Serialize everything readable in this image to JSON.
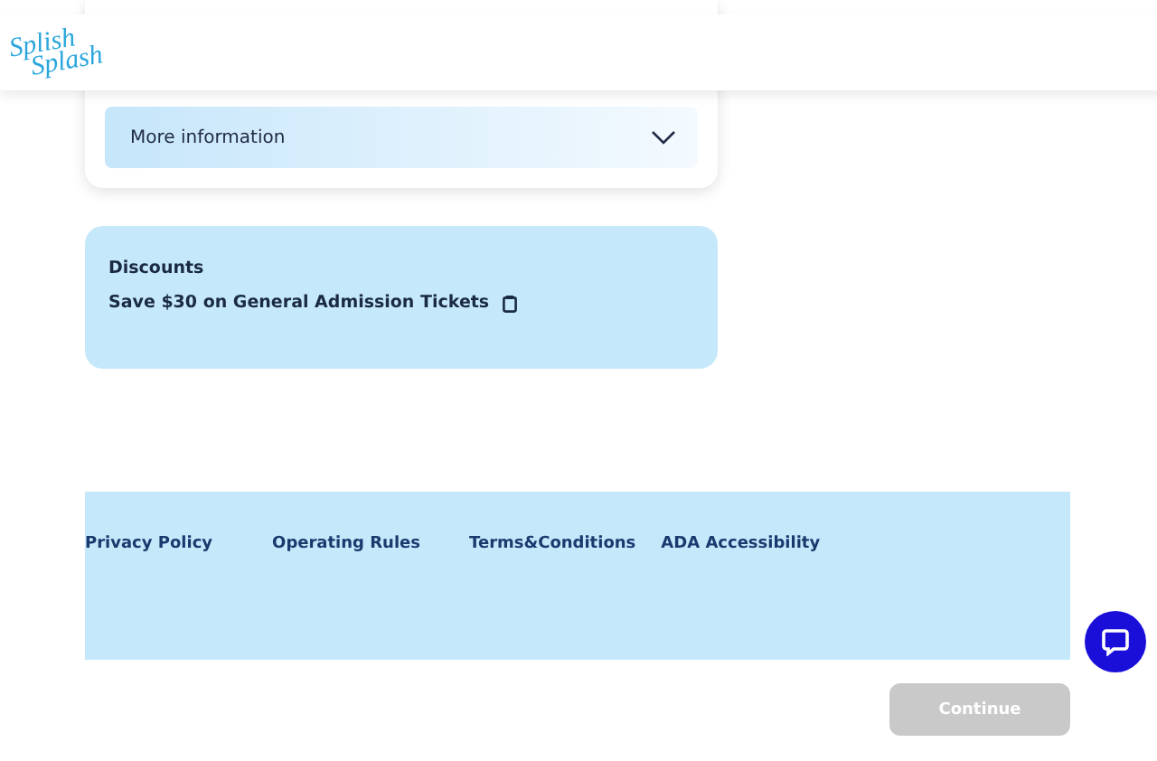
{
  "header": {
    "logo": [
      "Splish",
      "Splash"
    ]
  },
  "info_card": {
    "accordion": {
      "label": "More information",
      "expanded": false
    }
  },
  "discounts": {
    "title": "Discounts",
    "items": [
      "Save $30 on General Admission Tickets"
    ]
  },
  "footer": {
    "links": [
      "Privacy Policy",
      "Operating Rules",
      "Terms&Conditions",
      "ADA Accessibility"
    ]
  },
  "bottom_bar": {
    "button": {
      "label": "Continue",
      "disabled": true
    }
  }
}
